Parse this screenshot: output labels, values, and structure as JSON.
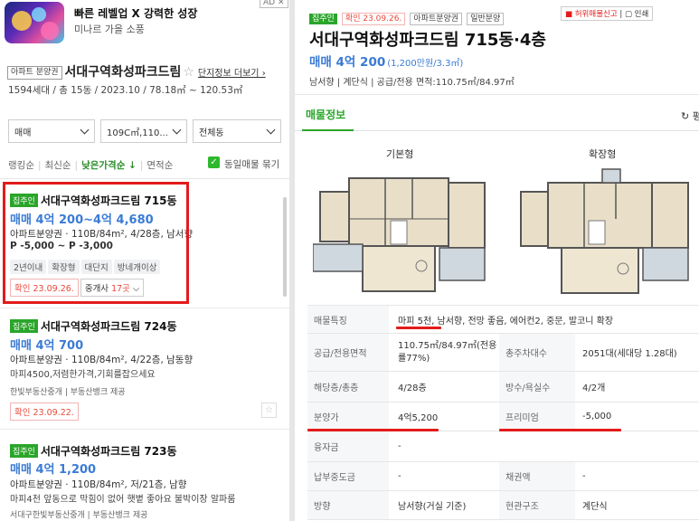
{
  "ad": {
    "title": "빠른 레벨업 X 강력한 성장",
    "subtitle": "미나르 가을 소풍",
    "badge": "AD ✕"
  },
  "complex": {
    "tag": "아파트 분양권",
    "name": "서대구역화성파크드림",
    "more": "단지정보 더보기",
    "info": "1594세대 / 총 15동 / 2023.10 / 78.18㎡ ~ 120.53㎡"
  },
  "filters": {
    "trade": "매매",
    "area": "109C㎡,110...",
    "building": "전체동"
  },
  "sort": {
    "items": [
      "랭킹순",
      "최신순",
      "낮은가격순",
      "면적순"
    ],
    "active": "낮은가격순 ↓",
    "group_label": "동일매물 묶기"
  },
  "listings": [
    {
      "badge": "집주인",
      "title": "서대구역화성파크드림 715동",
      "price": "매매 4억 200~4억 4,680",
      "line1": "아파트분양권 · 110B/84m², 4/28층, 남서향",
      "line2": "P -5,000 ~ P -3,000",
      "chips": [
        "2년이내",
        "확장형",
        "대단지",
        "방네개이상"
      ],
      "confirm": "확인 23.09.26.",
      "agent_prefix": "중개사 ",
      "agent_count": "17곳"
    },
    {
      "badge": "집주인",
      "title": "서대구역화성파크드림 724동",
      "price": "매매 4억 700",
      "line1": "아파트분양권 · 110B/84m², 4/22층, 남동향",
      "line2": "마피4500,저렴한가격,기회를잡으세요",
      "line3": "한빛부동산중개 | 부동산뱅크 제공",
      "confirm": "확인 23.09.22."
    },
    {
      "badge": "집주인",
      "title": "서대구역화성파크드림 723동",
      "price": "매매 4억 1,200",
      "line1": "아파트분양권 · 110B/84m², 저/21층, 남향",
      "line2": "마피4천 앞동으로 막힘이 없어 햇볕 좋아요 불박이장 알파룸",
      "line3": "서대구한빛부동산중개 | 부동산뱅크 제공"
    }
  ],
  "detail": {
    "badges": [
      "집주인",
      "확인 23.09.26.",
      "아파트분양권",
      "일반분양"
    ],
    "report": "허위매물신고",
    "print": "인쇄",
    "title": "서대구역화성파크드림 715동·4층",
    "price": "매매 4억 200",
    "price_unit": "(1,200만원/3.3㎡)",
    "info": "남서향 | 계단식 | 공급/전용 면적:110.75㎡/84.97㎡",
    "tab": "매물정보",
    "compare": "평",
    "plans": [
      "기본형",
      "확장형"
    ],
    "rows": [
      {
        "k": "매물특징",
        "v": "마피 5천, 남서향, 전망 좋음, 에어컨2, 중문, 발코니 확장"
      },
      {
        "k": "공급/전용면적",
        "v": "110.75㎡/84.97㎡(전용률77%)",
        "k2": "총주차대수",
        "v2": "2051대(세대당 1.28대)"
      },
      {
        "k": "해당층/총층",
        "v": "4/28층",
        "k2": "방수/욕실수",
        "v2": "4/2개"
      },
      {
        "k": "분양가",
        "v": "4억5,200",
        "k2": "프리미엄",
        "v2": "-5,000"
      },
      {
        "k": "융자금",
        "v": "-"
      },
      {
        "k": "납부중도금",
        "v": "-",
        "k2": "채권액",
        "v2": "-"
      },
      {
        "k": "방향",
        "v": "남서향(거실 기준)",
        "k2": "현관구조",
        "v2": "계단식"
      }
    ]
  }
}
